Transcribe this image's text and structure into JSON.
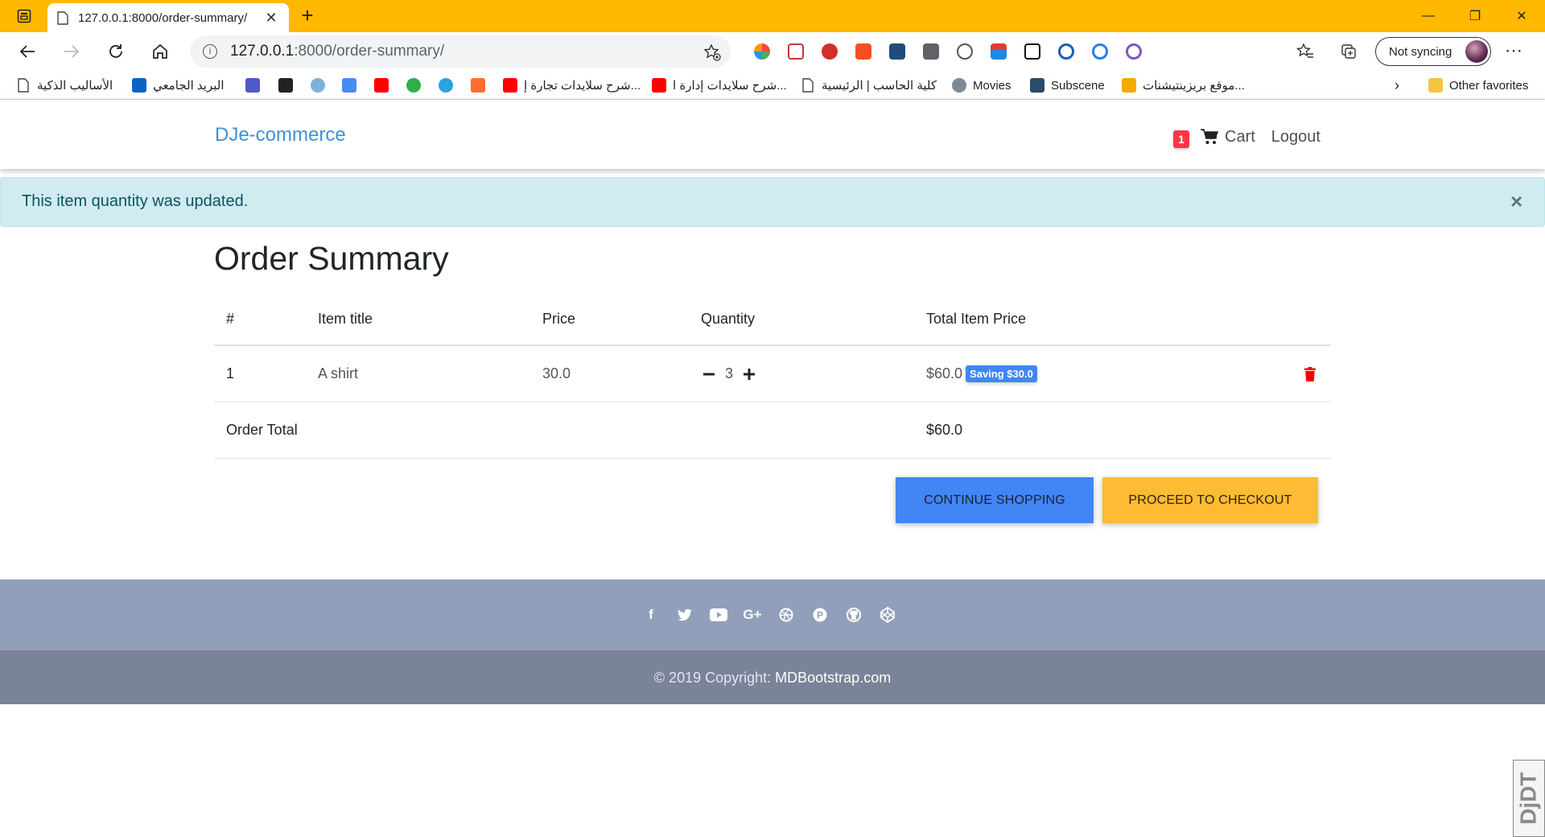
{
  "browser": {
    "tab_title": "127.0.0.1:8000/order-summary/",
    "url_host": "127.0.0.1",
    "url_path": ":8000/order-summary/",
    "sync_label": "Not syncing",
    "bookmarks": [
      {
        "label": "الأساليب الذكية",
        "icon": "document-icon"
      },
      {
        "label": "البريد الجامعي",
        "icon": "outlook-icon"
      },
      {
        "label": "شرح سلايدات تجارة إ...",
        "icon": "youtube-icon"
      },
      {
        "label": "شرح سلايدات إدارة ا...",
        "icon": "youtube-icon"
      },
      {
        "label": "كلية الحاسب | الرئيسية",
        "icon": "document-icon"
      },
      {
        "label": "Movies",
        "icon": "movies-icon"
      },
      {
        "label": "Subscene",
        "icon": "subscene-icon"
      },
      {
        "label": "موقع بريزينتيشنات...",
        "icon": "slides-icon"
      }
    ],
    "other_favorites": "Other favorites"
  },
  "navbar": {
    "brand": "DJe-commerce",
    "cart_count": "1",
    "cart_label": "Cart",
    "logout_label": "Logout"
  },
  "alert": {
    "message": "This item quantity was updated.",
    "close": "×"
  },
  "page": {
    "title": "Order Summary"
  },
  "table": {
    "headers": [
      "#",
      "Item title",
      "Price",
      "Quantity",
      "Total Item Price"
    ],
    "rows": [
      {
        "num": "1",
        "title": "A shirt",
        "price": "30.0",
        "quantity": "3",
        "total": "$60.0",
        "saving": "Saving $30.0"
      }
    ],
    "order_total_label": "Order Total",
    "order_total_value": "$60.0"
  },
  "buttons": {
    "continue": "CONTINUE SHOPPING",
    "checkout": "PROCEED TO CHECKOUT"
  },
  "footer": {
    "social_icons": [
      "facebook-icon",
      "twitter-icon",
      "youtube-icon",
      "google-plus-icon",
      "dribbble-icon",
      "pinterest-icon",
      "github-icon",
      "codepen-icon"
    ],
    "copyright": "© 2019 Copyright: ",
    "copyright_link": "MDBootstrap.com"
  },
  "overlay": {
    "ddt_label": "DjDT"
  },
  "colors": {
    "titlebar": "#ffb900",
    "brand": "#3f8fd8",
    "alert_bg": "#d1ecf1",
    "primary_button": "#4285f4",
    "warning_button": "#ffbb33",
    "footer_top": "#919fba",
    "footer_bottom": "#7a8399",
    "badge": "#ff3547",
    "trash": "#ff0000"
  }
}
